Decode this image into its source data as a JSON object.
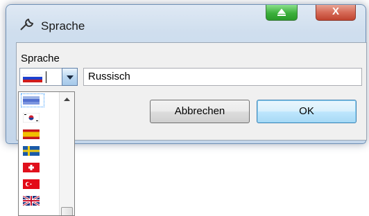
{
  "window": {
    "title": "Sprache",
    "title_icon": "wrench-icon",
    "extra_button_icon": "eject-icon",
    "close_label": "X"
  },
  "group": {
    "label": "Sprache"
  },
  "combo": {
    "selected_flag": "russia-flag-icon"
  },
  "text_field": {
    "value": "Russisch"
  },
  "buttons": {
    "cancel": "Abbrechen",
    "ok": "OK"
  },
  "dropdown": {
    "items": [
      {
        "flag": "russia-flag-icon",
        "selected": true
      },
      {
        "flag": "south-korea-flag-icon"
      },
      {
        "flag": "spain-flag-icon"
      },
      {
        "flag": "sweden-flag-icon"
      },
      {
        "flag": "switzerland-flag-icon"
      },
      {
        "flag": "turkey-flag-icon"
      },
      {
        "flag": "united-kingdom-flag-icon"
      }
    ]
  },
  "colors": {
    "titlebar": "#cfdeee",
    "ok_button": "#bee6fd",
    "focus": "#3399ff"
  }
}
